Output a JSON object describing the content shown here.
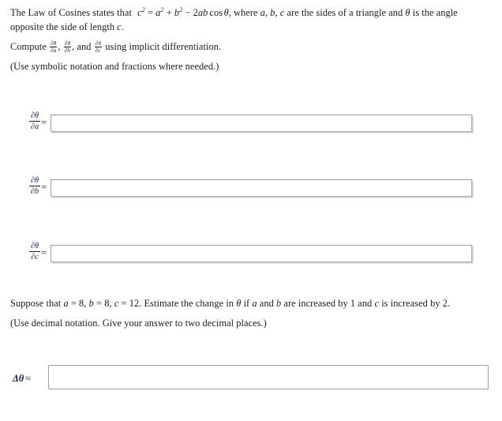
{
  "problem": {
    "intro": {
      "lead": "The Law of Cosines states that",
      "equation": {
        "lhs_base": "c",
        "lhs_exp": "2",
        "eq": "=",
        "t1_base": "a",
        "t1_exp": "2",
        "plus": "+",
        "t2_base": "b",
        "t2_exp": "2",
        "minus": "−",
        "t3_coef": "2",
        "t3_vars": "ab",
        "t3_fn": "cos",
        "t3_angle": "θ"
      },
      "tail_1": ", where",
      "vars": "a, b, c",
      "tail_2": "are the sides of a triangle and",
      "theta": "θ",
      "tail_3": "is the angle opposite the side of length",
      "side": "c",
      "period": "."
    },
    "compute": {
      "lead": "Compute",
      "frac1": {
        "num": "∂θ",
        "den": "∂a"
      },
      "sep1": ",",
      "frac2": {
        "num": "∂θ",
        "den": "∂b"
      },
      "sep2": ", and",
      "frac3": {
        "num": "∂θ",
        "den": "∂c"
      },
      "tail": "using implicit differentiation."
    },
    "note_symbolic": "(Use symbolic notation and fractions where needed.)",
    "suppose": {
      "lead": "Suppose that",
      "a_var": "a",
      "a_eq": "=",
      "a_val": "8",
      "c1": ",",
      "b_var": "b",
      "b_eq": "=",
      "b_val": "8",
      "c2": ",",
      "c_var": "c",
      "c_eq": "=",
      "c_val": "12",
      "mid_1": ". Estimate the change in",
      "theta": "θ",
      "mid_2": "if",
      "av": "a",
      "mid_3": "and",
      "bv": "b",
      "mid_4": "are increased by",
      "delta_ab": "1",
      "mid_5": "and",
      "cv": "c",
      "mid_6": "is increased by",
      "delta_c": "2",
      "end": "."
    },
    "note_decimal": "(Use decimal notation. Give your answer to two decimal places.)"
  },
  "answers": {
    "rows": [
      {
        "label_num": "∂θ",
        "label_den": "∂a",
        "equals": "=",
        "value": "",
        "placeholder": ""
      },
      {
        "label_num": "∂θ",
        "label_den": "∂b",
        "equals": "=",
        "value": "",
        "placeholder": ""
      },
      {
        "label_num": "∂θ",
        "label_den": "∂c",
        "equals": "=",
        "value": "",
        "placeholder": ""
      }
    ],
    "final": {
      "label_delta": "Δθ",
      "label_approx": "≈",
      "value": "",
      "placeholder": ""
    }
  },
  "colors": {
    "math_accent": "#14224f",
    "text": "#1c1c1c",
    "input_border": "#a8a8a8",
    "input_shadow": "#c9c9c9",
    "final_input_border": "#9e9e9e",
    "background": "#ffffff"
  }
}
